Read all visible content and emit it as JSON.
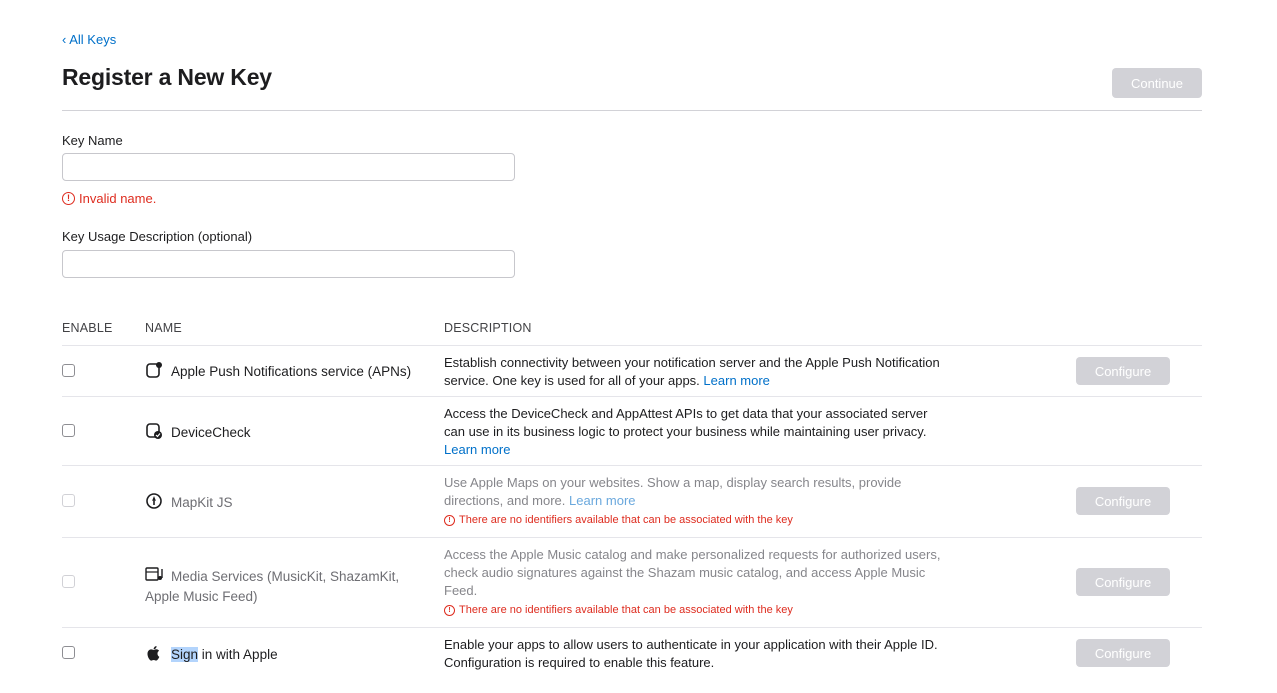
{
  "nav": {
    "back_label": "All Keys"
  },
  "header": {
    "title": "Register a New Key",
    "continue_label": "Continue"
  },
  "form": {
    "key_name_label": "Key Name",
    "key_name_value": "",
    "key_name_error": "Invalid name.",
    "description_label": "Key Usage Description (optional)",
    "description_value": ""
  },
  "table": {
    "columns": {
      "enable": "ENABLE",
      "name": "NAME",
      "description": "DESCRIPTION"
    },
    "configure_label": "Configure",
    "rows": [
      {
        "name": "Apple Push Notifications service (APNs)",
        "icon": "push-notification-icon",
        "description": "Establish connectivity between your notification server and the Apple Push Notification service. One key is used for all of your apps.",
        "link": "Learn more",
        "enabled": true,
        "has_configure": true
      },
      {
        "name": "DeviceCheck",
        "icon": "device-check-icon",
        "description": "Access the DeviceCheck and AppAttest APIs to get data that your associated server can use in its business logic to protect your business while maintaining user privacy.",
        "link": "Learn more",
        "enabled": true,
        "has_configure": false
      },
      {
        "name": "MapKit JS",
        "icon": "mapkit-compass-icon",
        "description": "Use Apple Maps on your websites. Show a map, display search results, provide directions, and more.",
        "link": "Learn more",
        "warning": "There are no identifiers available that can be associated with the key",
        "enabled": false,
        "has_configure": true
      },
      {
        "name": "Media Services (MusicKit, ShazamKit, Apple Music Feed)",
        "icon": "media-services-icon",
        "description": "Access the Apple Music catalog and make personalized requests for authorized users, check audio signatures against the Shazam music catalog, and access Apple Music Feed.",
        "warning": "There are no identifiers available that can be associated with the key",
        "enabled": false,
        "has_configure": true
      },
      {
        "name_highlight": "Sign",
        "name_rest": " in with Apple",
        "icon": "apple-logo-icon",
        "description": "Enable your apps to allow users to authenticate in your application with their Apple ID. Configuration is required to enable this feature.",
        "enabled": true,
        "has_configure": true
      }
    ]
  },
  "colors": {
    "link": "#0070c9",
    "error": "#de2c1f",
    "disabled_button": "#d2d2d7"
  }
}
